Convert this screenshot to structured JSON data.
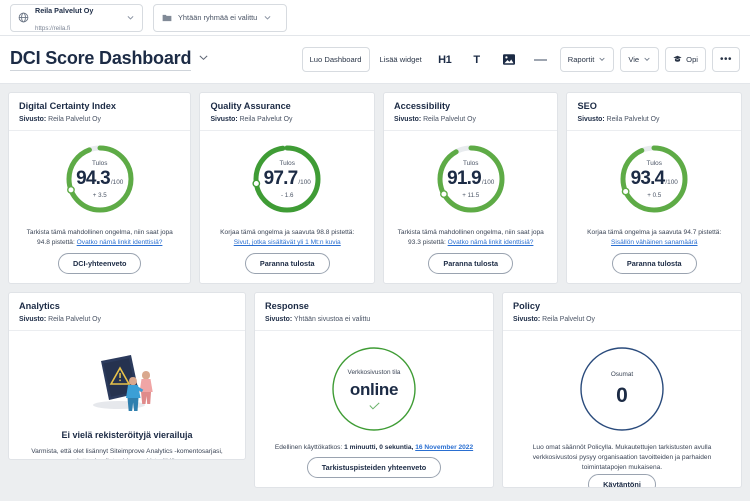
{
  "topbar": {
    "site_selector": {
      "icon": "globe-icon",
      "name": "Reila Palvelut Oy",
      "url": "https://reila.fi",
      "chevron": "chevron-down-icon"
    },
    "group_selector": {
      "icon": "group-icon",
      "label": "Yhtään ryhmää ei valittu",
      "chevron": "chevron-down-icon"
    }
  },
  "header": {
    "title": "DCI Score Dashboard",
    "title_chevron": "chevron-down-icon",
    "toolbar": {
      "create_dashboard": "Luo Dashboard",
      "add_widget": "Lisää widget",
      "heading_icon": "H1",
      "text_icon": "T",
      "image_icon": "image-icon",
      "divider_icon": "horizontal-rule-icon",
      "reports": "Raportit",
      "export": "Vie",
      "learn": "Opi",
      "learn_icon": "graduation-cap-icon",
      "more": "•••"
    }
  },
  "cards": {
    "dci": {
      "title": "Digital Certainty Index",
      "site_label": "Sivusto:",
      "site_value": "Reila Palvelut Oy",
      "gauge_label": "Tulos",
      "score": "94.3",
      "max": "/100",
      "delta": "+ 3.5",
      "percent": 94.3,
      "color": "#5eab46",
      "desc_prefix": "Tarkista tämä mahdollinen ongelma, niin saat jopa 94.8 pistettä: ",
      "desc_link": "Ovatko nämä linkit identtisiä?",
      "button": "DCI-yhteenveto"
    },
    "qa": {
      "title": "Quality Assurance",
      "site_label": "Sivusto:",
      "site_value": "Reila Palvelut Oy",
      "gauge_label": "Tulos",
      "score": "97.7",
      "max": "/100",
      "delta": "- 1.6",
      "percent": 97.7,
      "color": "#3f9c35",
      "desc_prefix": "Korjaa tämä ongelma ja saavuta 98.8 pistettä: ",
      "desc_link": "Sivut, jotka sisältävät yli 1 Mt:n kuvia",
      "button": "Paranna tulosta"
    },
    "accessibility": {
      "title": "Accessibility",
      "site_label": "Sivusto:",
      "site_value": "Reila Palvelut Oy",
      "gauge_label": "Tulos",
      "score": "91.9",
      "max": "/100",
      "delta": "+ 11.5",
      "percent": 91.9,
      "color": "#5eab46",
      "desc_prefix": "Tarkista tämä mahdollinen ongelma, niin saat jopa 93.3 pistettä: ",
      "desc_link": "Ovatko nämä linkit identtisiä?",
      "button": "Paranna tulosta"
    },
    "seo": {
      "title": "SEO",
      "site_label": "Sivusto:",
      "site_value": "Reila Palvelut Oy",
      "gauge_label": "Tulos",
      "score": "93.4",
      "max": "/100",
      "delta": "+ 0.5",
      "percent": 93.4,
      "color": "#5eab46",
      "desc_prefix": "Korjaa tämä ongelma ja saavuta 94.7 pistettä: ",
      "desc_link": "Sisällön vähäinen sanamäärä",
      "button": "Paranna tulosta"
    },
    "analytics": {
      "title": "Analytics",
      "site_label": "Sivusto:",
      "site_value": "Reila Palvelut Oy",
      "empty_title": "Ei vielä rekisteröityjä vierailuja",
      "empty_text": "Varmista, että olet lisännyt Siteimprove Analytics -komentosarjasi, jotta vierailut voidaan rekisteröidä."
    },
    "response": {
      "title": "Response",
      "site_label": "Sivusto:",
      "site_value": "Yhtään sivustoa ei valittu",
      "circle_label": "Verkkosivuston tila",
      "status": "online",
      "status_icon": "check-icon",
      "color": "#3f9c35",
      "note_prefix": "Edellinen käyttökatkos: ",
      "note_value": "1 minuutti, 0 sekuntia, ",
      "note_link": "16 November 2022",
      "button": "Tarkistuspisteiden yhteenveto"
    },
    "policy": {
      "title": "Policy",
      "site_label": "Sivusto:",
      "site_value": "Reila Palvelut Oy",
      "circle_label": "Osumat",
      "value": "0",
      "color": "#2a4b7c",
      "text": "Luo omat säännöt Policylla. Mukautettujen tarkistusten avulla verkkosivustosi pysyy organisaation tavoitteiden ja parhaiden toimintatapojen mukaisena.",
      "button": "Käytäntöni"
    }
  }
}
